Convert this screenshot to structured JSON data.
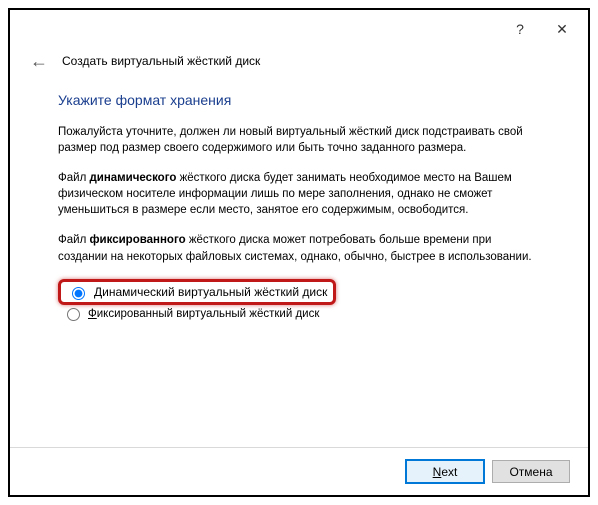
{
  "titlebar": {
    "help_icon": "?",
    "close_icon": "✕"
  },
  "header": {
    "back_icon": "←",
    "title": "Создать виртуальный жёсткий диск"
  },
  "content": {
    "heading": "Укажите формат хранения",
    "para1": "Пожалуйста уточните, должен ли новый виртуальный жёсткий диск подстраивать свой размер под размер своего содержимого или быть точно заданного размера.",
    "para2_a": "Файл ",
    "para2_b": "динамического",
    "para2_c": " жёсткого диска будет занимать необходимое место на Вашем физическом носителе информации лишь по мере заполнения, однако не сможет уменьшиться в размере если место, занятое его содержимым, освободится.",
    "para3_a": "Файл ",
    "para3_b": "фиксированного",
    "para3_c": " жёсткого диска может потребовать больше времени при создании на некоторых файловых системах, однако, обычно, быстрее в использовании.",
    "radio_dynamic": "Динамический виртуальный жёсткий диск",
    "radio_fixed": "Фиксированный виртуальный жёсткий диск"
  },
  "footer": {
    "next": "Next",
    "cancel": "Отмена"
  }
}
